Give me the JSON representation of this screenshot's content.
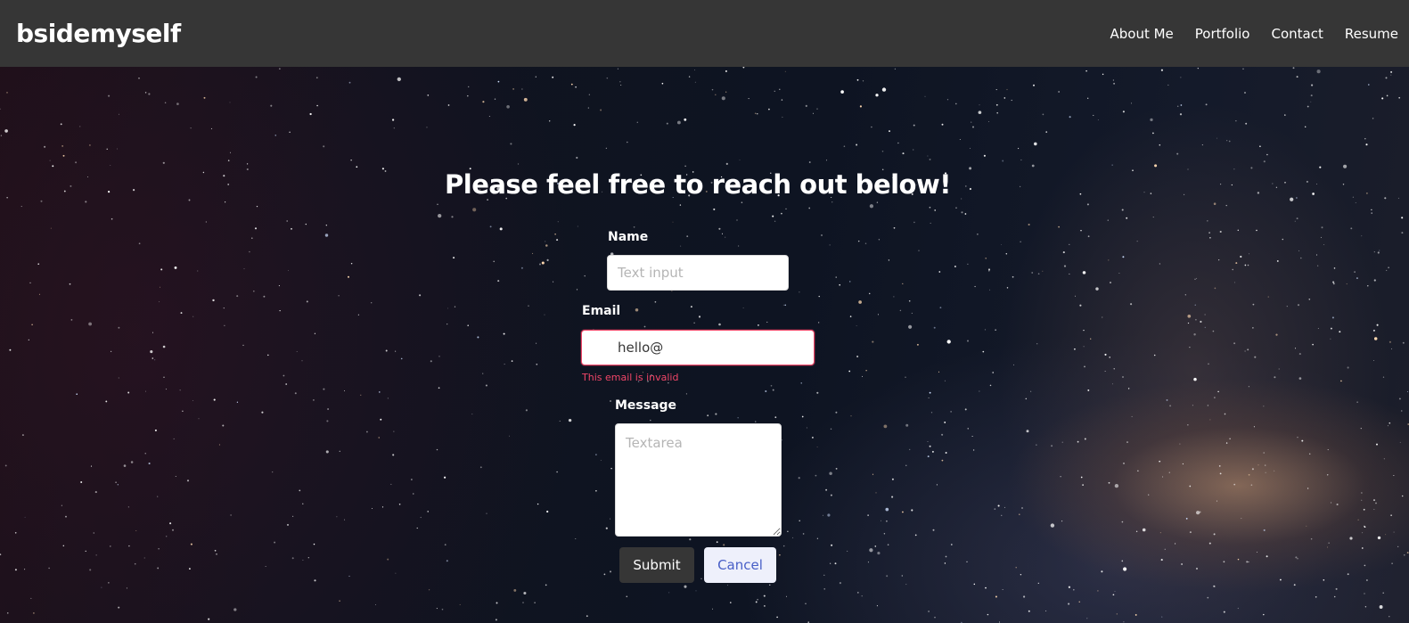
{
  "header": {
    "brand": "bsidemyself",
    "nav": [
      "About Me",
      "Portfolio",
      "Contact",
      "Resume"
    ]
  },
  "form": {
    "title": "Please feel free to reach out below!",
    "name_label": "Name",
    "name_placeholder": "Text input",
    "email_label": "Email",
    "email_value": "hello@",
    "email_error": "This email is invalid",
    "message_label": "Message",
    "message_placeholder": "Textarea",
    "submit_label": "Submit",
    "cancel_label": "Cancel"
  },
  "colors": {
    "navbar": "#363636",
    "danger": "#f14668",
    "link": "#485fc7"
  }
}
